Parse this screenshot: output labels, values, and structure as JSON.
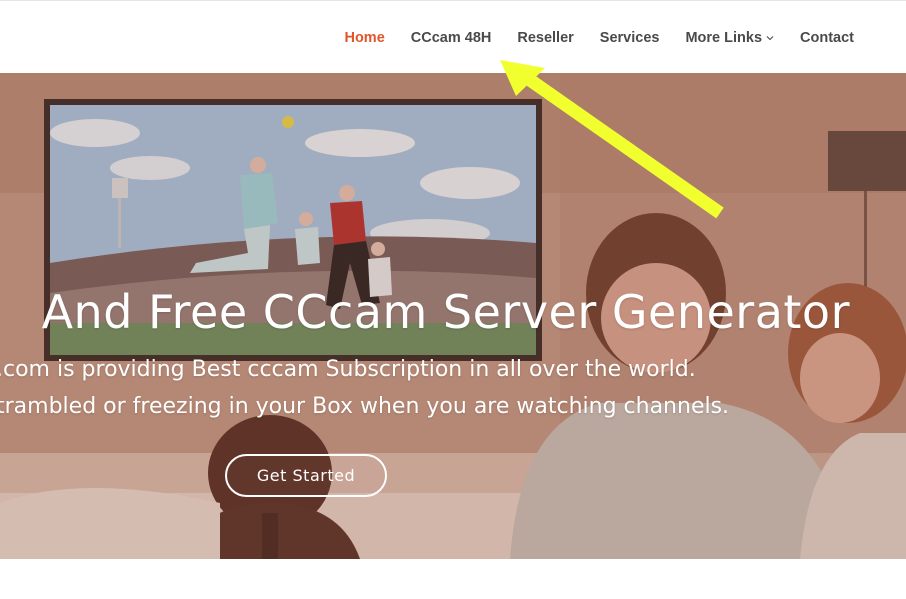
{
  "nav": {
    "items": [
      {
        "label": "Home",
        "active": true
      },
      {
        "label": "CCcam 48H",
        "active": false
      },
      {
        "label": "Reseller",
        "active": false
      },
      {
        "label": "Services",
        "active": false
      },
      {
        "label": "More Links",
        "active": false,
        "dropdown": true
      },
      {
        "label": "Contact",
        "active": false
      }
    ],
    "active_color": "#e0552b",
    "text_color": "#4a4a4a"
  },
  "hero": {
    "title": "And Free CCcam Server Generator",
    "line1": ".com is providing Best cccam Subscription in all over the world.",
    "line2": "trambled or freezing in your Box when you are watching channels.",
    "cta_label": "Get Started"
  },
  "annotation": {
    "arrow_color": "#f2ff2e"
  }
}
